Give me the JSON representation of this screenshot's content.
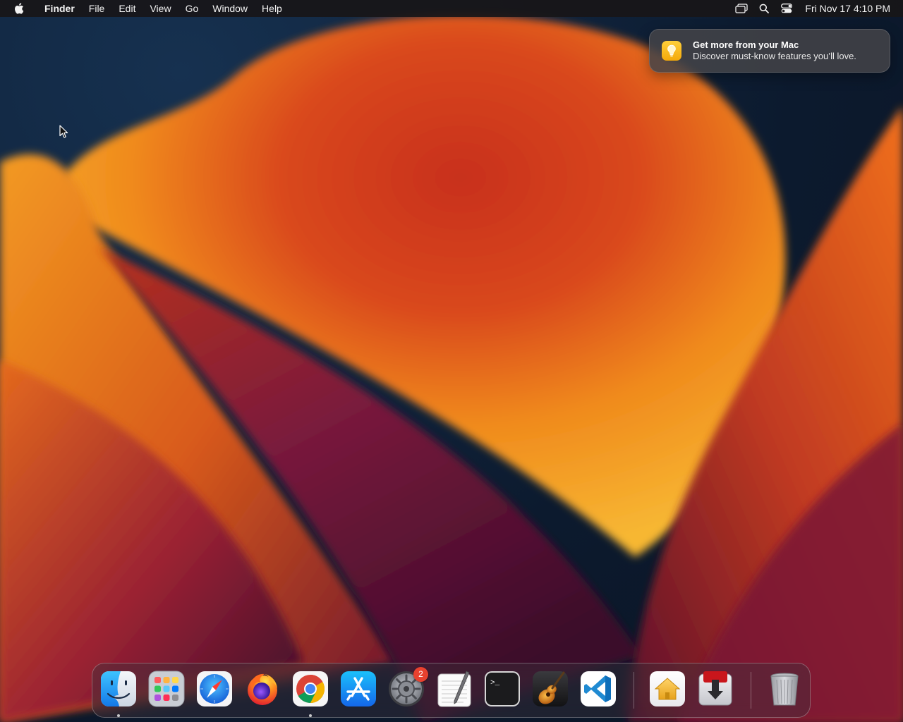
{
  "menubar": {
    "apple_icon": "apple-logo-icon",
    "app_name": "Finder",
    "menus": [
      "File",
      "Edit",
      "View",
      "Go",
      "Window",
      "Help"
    ],
    "status_icons": [
      "screen-mirroring-icon",
      "spotlight-search-icon",
      "control-center-icon"
    ],
    "clock": "Fri Nov 17  4:10 PM"
  },
  "notification": {
    "icon": "tips-lightbulb-icon",
    "title": "Get more from your Mac",
    "body": "Discover must-know features you’ll love."
  },
  "dock": {
    "apps": [
      {
        "name": "Finder",
        "icon": "finder-icon",
        "running": true
      },
      {
        "name": "Launchpad",
        "icon": "launchpad-icon",
        "running": false
      },
      {
        "name": "Safari",
        "icon": "safari-icon",
        "running": false
      },
      {
        "name": "Firefox",
        "icon": "firefox-icon",
        "running": false
      },
      {
        "name": "Google Chrome",
        "icon": "chrome-icon",
        "running": true
      },
      {
        "name": "App Store",
        "icon": "app-store-icon",
        "running": false
      },
      {
        "name": "System Settings",
        "icon": "system-settings-icon",
        "running": false,
        "badge": "2"
      },
      {
        "name": "TextEdit",
        "icon": "textedit-icon",
        "running": false
      },
      {
        "name": "Terminal",
        "icon": "terminal-icon",
        "running": false
      },
      {
        "name": "GarageBand",
        "icon": "garageband-icon",
        "running": false
      },
      {
        "name": "Visual Studio Code",
        "icon": "vscode-icon",
        "running": false
      },
      {
        "name": "Home",
        "icon": "home-folder-icon",
        "running": false
      },
      {
        "name": "Downloads",
        "icon": "downloads-icon",
        "running": false
      },
      {
        "name": "Trash",
        "icon": "trash-icon",
        "running": false
      }
    ]
  },
  "colors": {
    "menubar_bg": "#181618",
    "notification_bg": "#444448",
    "badge_red": "#e8412f",
    "wallpaper_orange": "#f08a1c",
    "wallpaper_navy": "#0c1a2e"
  }
}
